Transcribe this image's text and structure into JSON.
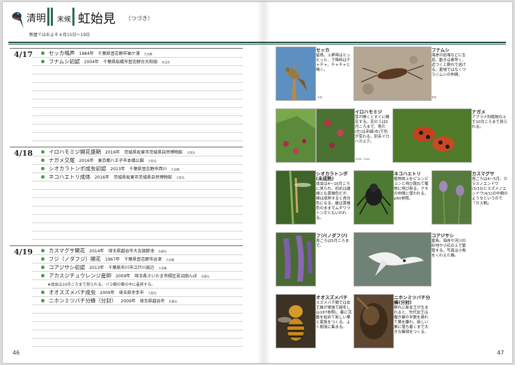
{
  "header": {
    "season": "清明",
    "kou_label": "末候",
    "title": "虹始見",
    "title_sub": "（つづき）",
    "date_range": "新暦ではおよそ４月15日～19日"
  },
  "left_page": {
    "page_number": "46",
    "sections": [
      {
        "date": "4/17",
        "entries": [
          {
            "name": "セッカ鳴声",
            "year": "1984年",
            "place": "千葉県習志野市袖ケ浦",
            "credit": "大迫義"
          },
          {
            "name": "フナムシ初認",
            "year": "2004年",
            "place": "千葉県船橋市習志野台大和田",
            "credit": "本田良"
          }
        ]
      },
      {
        "date": "4/18",
        "entries": [
          {
            "name": "イロハモミジ開花盛期",
            "year": "2016年",
            "place": "茨城県坂東市茨城県自然博物館",
            "credit": "大野浩"
          },
          {
            "name": "ナガメ交尾",
            "year": "2016年",
            "place": "東京都八王子市本橋公園",
            "credit": "大野浩"
          },
          {
            "name": "シオカラトンボ成虫初認",
            "year": "2013年",
            "place": "千葉県習志野市西川",
            "credit": "大迫義"
          },
          {
            "name": "ネコハエトリ成体",
            "year": "2016年",
            "place": "茨城県坂東市茨城県自然博物館",
            "credit": "大野浩"
          }
        ]
      },
      {
        "date": "4/19",
        "entries": [
          {
            "name": "カスマグサ開花",
            "year": "2014年",
            "place": "埼玉県越谷市大吉調節池",
            "credit": "佐藤弘"
          },
          {
            "name": "フジ（ノダフジ）開花",
            "year": "1967年",
            "place": "千葉県習志野市谷津",
            "credit": "大迫義"
          },
          {
            "name": "コアジサシ初認",
            "year": "2013年",
            "place": "千葉県市川市江戸川周辺",
            "credit": "大迫義"
          },
          {
            "name": "アカスジチュウレンジ産卵",
            "year": "2009年",
            "place": "埼玉県さいたま市緑区見沼田んぼ",
            "credit": "佐藤弘",
            "note": "★成虫は10月ころまで見られる。バラ類の葉の中に産卵する。"
          },
          {
            "name": "オオスズメバチ成虫",
            "year": "2009年",
            "place": "埼玉県幸手市",
            "credit": "大野浩"
          },
          {
            "name": "ニホンミツバチ分蜂（分封）",
            "year": "2009年",
            "place": "埼玉県越谷市",
            "credit": "佐藤弘"
          }
        ]
      }
    ]
  },
  "right_page": {
    "page_number": "47",
    "cards": [
      {
        "title": "セッカ",
        "body": "留鳥。上昇時はヒッヒッヒ、下降時はチャチャ、チャチャと鳴く。",
        "credit": "大迫"
      },
      {
        "title": "フナムシ",
        "body": "海岸の岩場などに生息。動きは素早く、近づくと群れで逃げる。夏場ではなくワラジムシの仲間。",
        "credit": "本田"
      },
      {
        "title": "イロハモミジ",
        "body": "芽が開くとすぐに開花する。花のうは5月ころまで、萼片(左)は赤緑(右)で色が変わる。別名イロハカエデ。",
        "credit": "1998・2000"
      },
      {
        "title": "ナガメ",
        "body": "アブラナ科植物の上で10月ころまで見られる。",
        "credit": ""
      },
      {
        "title": "シオカラトンボ(未成熟)",
        "body": "成虫は4～10月ころに見られ、初めは雌雄とも黄褐色だが、雄は成熟すると青白色になる。雌は黄褐色のままでムギワラトンボともいわれる。",
        "credit": ""
      },
      {
        "title": "ネコハエトリ",
        "body": "植物体上をピョンピョンと飛び跳ねて獲物に飛び掛る。クモの仲間に使われる。p60参照。",
        "credit": ""
      },
      {
        "title": "カスマグサ",
        "body": "見ごろは4～5月。カラスノエンドウ(3/13)とスズメノエンドウ(4/1)の中間のようなというので「カス間」",
        "credit": ""
      },
      {
        "title": "フジ(ノダフジ)",
        "body": "見ごろは5月ころまで。",
        "credit": ""
      },
      {
        "title": "コアジサシ",
        "body": "夏鳥。海岸や河川の砂地や小石の上で繁殖する。写真は小魚をくわえた雄。",
        "credit": ""
      },
      {
        "title": "オオスズメバチ",
        "body": "スズメバチ類では女王蜂が単独で越冬し(p187参照)、春に活動を始めて新しい巣と家族をつくる。よく樹液に集まる。",
        "credit": ""
      },
      {
        "title": "ニホンミツバチ分蜂(分封)",
        "body": "群れに新女王が生まれると、先代女王は働き蜂の半数を連れて巣を離れ、新しい巣に落ち着くまで大きな蜂球をつくる。",
        "credit": ""
      }
    ]
  }
}
